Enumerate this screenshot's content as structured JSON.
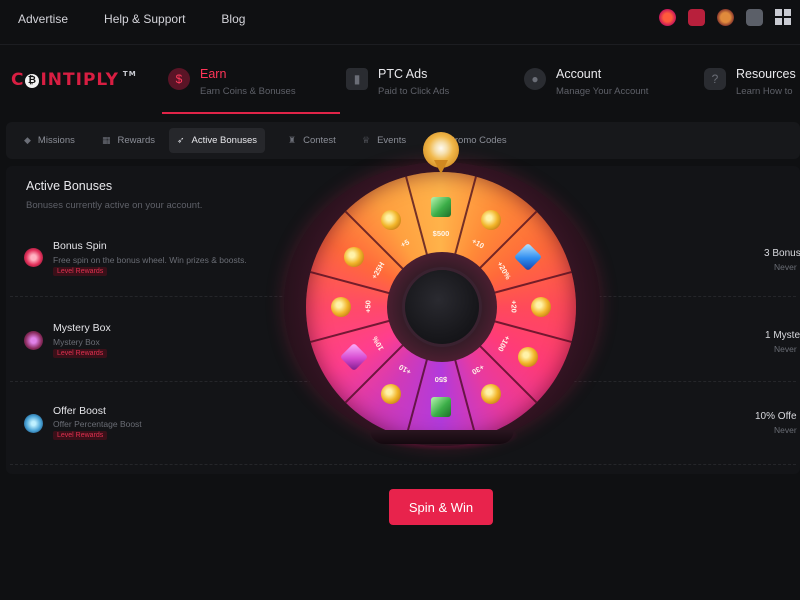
{
  "topbar": {
    "links": [
      "Advertise",
      "Help & Support",
      "Blog"
    ],
    "icons": [
      "wheel-icon",
      "gift-icon",
      "badge-icon",
      "chat-icon",
      "apps-icon"
    ]
  },
  "brand": {
    "logo": "COINTIPLY",
    "tm": "TM",
    "color": "#d81e42"
  },
  "nav": [
    {
      "title": "Earn",
      "subtitle": "Earn Coins & Bonuses",
      "icon": "dollar-icon",
      "active": true
    },
    {
      "title": "PTC Ads",
      "subtitle": "Paid to Click Ads",
      "icon": "ad-icon",
      "active": false
    },
    {
      "title": "Account",
      "subtitle": "Manage Your Account",
      "icon": "users-icon",
      "active": false
    },
    {
      "title": "Resources",
      "subtitle": "Learn How to",
      "icon": "question-icon",
      "active": false
    }
  ],
  "tabs": [
    {
      "label": "Missions",
      "icon": "diamond-icon",
      "active": false
    },
    {
      "label": "Rewards",
      "icon": "calendar-icon",
      "active": false
    },
    {
      "label": "Active Bonuses",
      "icon": "rocket-icon",
      "active": true
    },
    {
      "label": "Contest",
      "icon": "trophy-icon",
      "active": false
    },
    {
      "label": "Events",
      "icon": "trophy-cup-icon",
      "active": false
    },
    {
      "label": "Promo Codes",
      "icon": "ticket-icon",
      "active": false
    }
  ],
  "panel": {
    "title": "Active Bonuses",
    "subtitle": "Bonuses currently active on your account.",
    "bonuses": [
      {
        "name": "Bonus Spin",
        "description": "Free spin on the bonus wheel. Win prizes & boosts.",
        "tag": "Level Rewards",
        "value": "3 Bonus",
        "expiry": "Never"
      },
      {
        "name": "Mystery Box",
        "description": "Mystery Box",
        "tag": "Level Rewards",
        "value": "1 Myste",
        "expiry": "Never"
      },
      {
        "name": "Offer Boost",
        "description": "Offer Percentage Boost",
        "tag": "Level Rewards",
        "value": "10% Offe",
        "expiry": "Never"
      }
    ]
  },
  "wheel": {
    "segments": [
      "$500",
      "+10",
      "+20%",
      "+20",
      "+100",
      "+30",
      "$50",
      "+10",
      "10%",
      "+50",
      "+25H",
      "+5"
    ],
    "colors": {
      "gold": "#ffb34a",
      "pink": "#ff3b78",
      "purple": "#b23adc"
    }
  },
  "cta": {
    "label": "Spin & Win",
    "color": "#e8234c"
  }
}
